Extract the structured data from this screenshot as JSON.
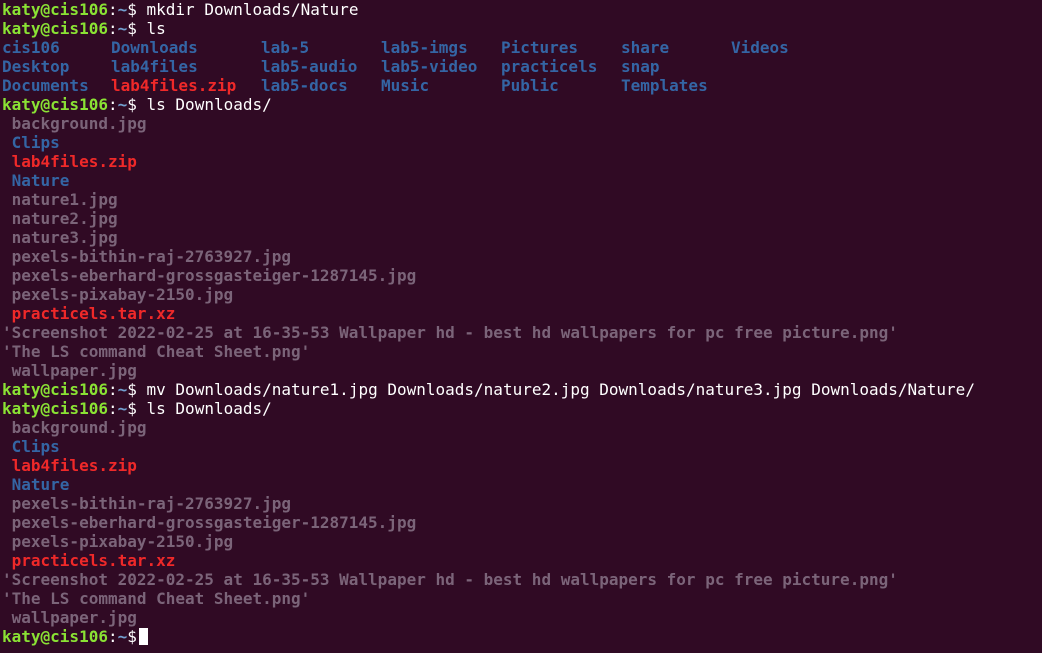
{
  "prompt": {
    "user_host": "katy@cis106",
    "path": "~",
    "symbol": "$"
  },
  "lines": {
    "l1_cmd": " mkdir Downloads/Nature",
    "l2_cmd": " ls",
    "l3": [
      "cis106",
      "Downloads",
      "lab-5",
      "lab5-imgs",
      "Pictures",
      "share",
      "Videos"
    ],
    "l4": [
      "Desktop",
      "lab4files",
      "lab5-audio",
      "lab5-video",
      "practicels",
      "snap"
    ],
    "l5": [
      "Documents",
      "lab4files.zip",
      "lab5-docs",
      "Music",
      "Public",
      "Templates"
    ],
    "l6_cmd": " ls Downloads/",
    "listing1": {
      "background": " background.jpg",
      "clips": " Clips",
      "lab4zip": " lab4files.zip",
      "nature": " Nature",
      "nature1": " nature1.jpg",
      "nature2": " nature2.jpg",
      "nature3": " nature3.jpg",
      "pexels1": " pexels-bithin-raj-2763927.jpg",
      "pexels2": " pexels-eberhard-grossgasteiger-1287145.jpg",
      "pexels3": " pexels-pixabay-2150.jpg",
      "practicels": " practicels.tar.xz",
      "screenshot": "'Screenshot 2022-02-25 at 16-35-53 Wallpaper hd - best hd wallpapers for pc free picture.png'",
      "cheatsheet": "'The LS command Cheat Sheet.png'",
      "wallpaper": " wallpaper.jpg"
    },
    "mv_cmd": " mv Downloads/nature1.jpg Downloads/nature2.jpg Downloads/nature3.jpg Downloads/Nature/",
    "ls2_cmd": " ls Downloads/",
    "listing2": {
      "background": " background.jpg",
      "clips": " Clips",
      "lab4zip": " lab4files.zip",
      "nature": " Nature",
      "pexels1": " pexels-bithin-raj-2763927.jpg",
      "pexels2": " pexels-eberhard-grossgasteiger-1287145.jpg",
      "pexels3": " pexels-pixabay-2150.jpg",
      "practicels": " practicels.tar.xz",
      "screenshot": "'Screenshot 2022-02-25 at 16-35-53 Wallpaper hd - best hd wallpapers for pc free picture.png'",
      "cheatsheet": "'The LS command Cheat Sheet.png'",
      "wallpaper": " wallpaper.jpg"
    }
  },
  "colors": {
    "background": "#300a24",
    "user": "#8ae234",
    "path": "#729fcf",
    "directory": "#3465a4",
    "archive": "#ef2929",
    "file": "#7b6479"
  }
}
